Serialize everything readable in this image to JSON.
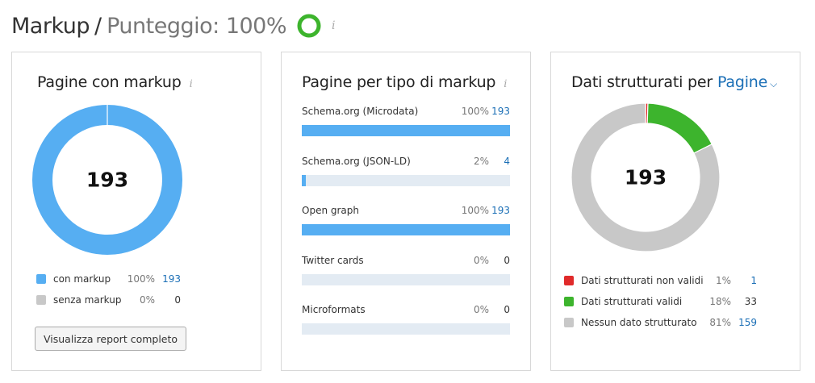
{
  "header": {
    "title": "Markup",
    "separator": "/",
    "score_label": "Punteggio: 100%",
    "score_value": 100,
    "info": "i"
  },
  "pages_card": {
    "title": "Pagine con markup",
    "info": "i",
    "total": "193",
    "colors": {
      "with": "#56aef2",
      "without": "#c8c8c8"
    },
    "legend": [
      {
        "label": "con markup",
        "pct": "100%",
        "value": "193",
        "share": 100,
        "color": "#56aef2"
      },
      {
        "label": "senza markup",
        "pct": "0%",
        "value": "0",
        "share": 0,
        "color": "#c8c8c8"
      }
    ],
    "button_label": "Visualizza report completo"
  },
  "types_card": {
    "title": "Pagine per tipo di markup",
    "info": "i",
    "rows": [
      {
        "label": "Schema.org (Microdata)",
        "pct": "100%",
        "value": "193",
        "share": 100
      },
      {
        "label": "Schema.org (JSON-LD)",
        "pct": "2%",
        "value": "4",
        "share": 2
      },
      {
        "label": "Open graph",
        "pct": "100%",
        "value": "193",
        "share": 100
      },
      {
        "label": "Twitter cards",
        "pct": "0%",
        "value": "0",
        "share": 0
      },
      {
        "label": "Microformats",
        "pct": "0%",
        "value": "0",
        "share": 0
      }
    ]
  },
  "structured_card": {
    "title": "Dati strutturati per",
    "dropdown_label": "Pagine",
    "total": "193",
    "legend": [
      {
        "label": "Dati strutturati non validi",
        "pct": "1%",
        "value": "1",
        "count": 1,
        "color": "#e02a2a"
      },
      {
        "label": "Dati strutturati validi",
        "pct": "18%",
        "value": "33",
        "count": 33,
        "color": "#3db42d"
      },
      {
        "label": "Nessun dato strutturato",
        "pct": "81%",
        "value": "159",
        "count": 159,
        "color": "#c8c8c8"
      }
    ]
  }
}
